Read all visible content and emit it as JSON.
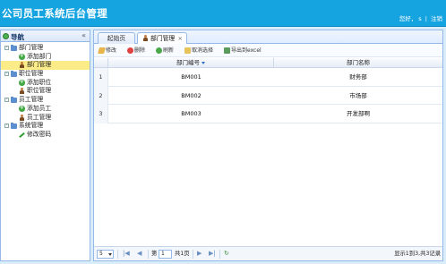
{
  "header": {
    "title": "公司员工系统后台管理",
    "greeting": "您好，",
    "username": "s",
    "separator": "|",
    "logout_label": "注销"
  },
  "nav": {
    "title": "导航",
    "collapse_glyph": "«",
    "tree": [
      {
        "label": "部门管理",
        "type": "folder"
      },
      {
        "label": "添加部门",
        "type": "plus"
      },
      {
        "label": "部门管理",
        "type": "user",
        "selected": true
      },
      {
        "label": "职位管理",
        "type": "folder"
      },
      {
        "label": "添加职位",
        "type": "plus"
      },
      {
        "label": "职位管理",
        "type": "user"
      },
      {
        "label": "员工管理",
        "type": "folder"
      },
      {
        "label": "添加员工",
        "type": "plus"
      },
      {
        "label": "员工管理",
        "type": "user"
      },
      {
        "label": "系统管理",
        "type": "folder"
      },
      {
        "label": "修改密码",
        "type": "pencil"
      }
    ]
  },
  "tabs": [
    {
      "label": "起始页"
    },
    {
      "label": "部门管理",
      "active": true,
      "close_glyph": "×"
    }
  ],
  "toolbar": {
    "edit_label": "修改",
    "delete_label": "删除",
    "refresh_label": "刷新",
    "cancel_label": "取消选择",
    "export_label": "导出到excel"
  },
  "grid": {
    "columns": [
      "部门编号",
      "部门名称"
    ],
    "rows": [
      {
        "num": "1",
        "code": "BM001",
        "name": "财务部"
      },
      {
        "num": "2",
        "code": "BM002",
        "name": "市场部"
      },
      {
        "num": "3",
        "code": "BM003",
        "name": "开发部啊"
      }
    ]
  },
  "pager": {
    "page_size": "5",
    "first_glyph": "|◀",
    "prev_glyph": "◀",
    "page_prefix": "第",
    "current_page": "1",
    "page_suffix": "共1页",
    "next_glyph": "▶",
    "last_glyph": "▶|",
    "refresh_glyph": "↻",
    "info": "显示1到3,共3记录"
  },
  "colors": {
    "header_bg": "#15a4e0",
    "panel_border": "#95b8e7",
    "selected_row": "#fbec88"
  }
}
